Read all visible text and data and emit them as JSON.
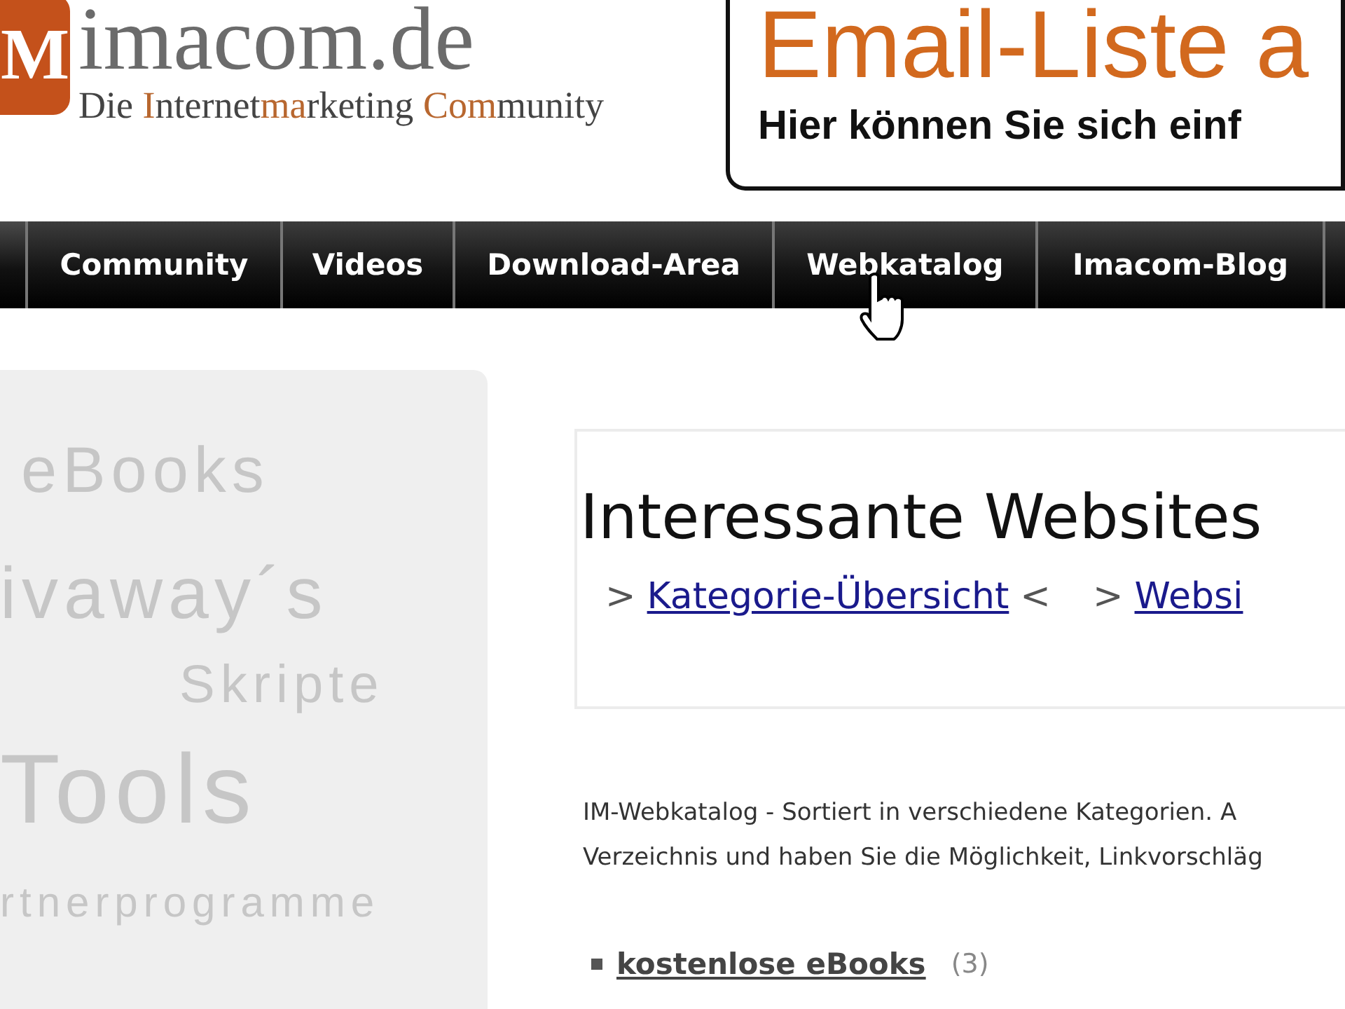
{
  "header": {
    "logo_mark": "M",
    "site_name": "imacom.de",
    "tagline": [
      {
        "text": "Die ",
        "accent": false
      },
      {
        "text": "I",
        "accent": true
      },
      {
        "text": "nternet",
        "accent": false
      },
      {
        "text": "ma",
        "accent": true
      },
      {
        "text": "rketing ",
        "accent": false
      },
      {
        "text": "Com",
        "accent": true
      },
      {
        "text": "munity",
        "accent": false
      }
    ],
    "banner": {
      "title": "Email-Liste a",
      "subtitle": "Hier können Sie sich einf"
    }
  },
  "nav": {
    "items": [
      "Community",
      "Videos",
      "Download-Area",
      "Webkatalog",
      "Imacom-Blog"
    ]
  },
  "tag_cloud": [
    "eBooks",
    "ivaway´s",
    "Skripte",
    "Tools",
    "rtnerprogramme"
  ],
  "content": {
    "title": "Interessante Websites",
    "links": [
      {
        "before": ">",
        "label": "Kategorie-Übersicht",
        "after": "<"
      },
      {
        "before": ">",
        "label": "Websi"
      }
    ],
    "description": [
      "IM-Webkatalog - Sortiert in verschiedene Kategorien. A",
      "Verzeichnis und haben Sie die Möglichkeit, Linkvorschläg"
    ],
    "categories": [
      {
        "label": "kostenlose eBooks",
        "count": "(3)"
      }
    ]
  }
}
